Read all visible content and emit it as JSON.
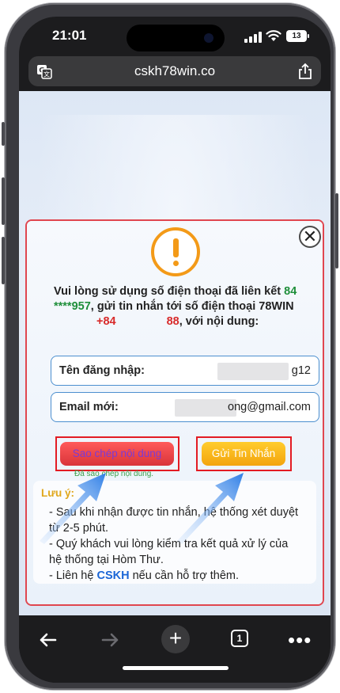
{
  "status_bar": {
    "time": "21:01",
    "battery": "13"
  },
  "browser": {
    "url": "cskh78win.co",
    "tab_count": "1"
  },
  "dialog": {
    "message": {
      "part1": "Vui lòng sử dụng số điện thoại đã liên kết",
      "phone_prefix": "84",
      "phone_suffix": "****957",
      "part2": ", gửi tin nhắn tới số điện thoại 78WIN",
      "target_prefix": "+84",
      "target_suffix": "88",
      "part3": ", với nội dung:"
    },
    "username": {
      "label": "Tên đăng nhập:",
      "value": "g12"
    },
    "email": {
      "label": "Email mới:",
      "value": "ong@gmail.com"
    },
    "copy_button": "Sao chép nội dung",
    "copied_status": "Đã sao chép nội dung.",
    "send_button": "Gửi Tin Nhắn",
    "notes": {
      "title": "Lưu ý:",
      "item1": "- Sau khi nhận được tin nhắn, hệ thống xét duyệt từ 2-5 phút.",
      "item2": "- Quý khách vui lòng kiểm tra kết quả xử lý của hệ thống tại Hòm Thư.",
      "item3_before": "- Liên hệ ",
      "item3_link": "CSKH",
      "item3_after": " nếu cần hỗ trợ thêm."
    }
  },
  "colors": {
    "accent_red": "#e31b23",
    "phone_green": "#1f8f3a",
    "arrow_blue": "#2f7fe6",
    "warning_orange": "#f39a18"
  }
}
